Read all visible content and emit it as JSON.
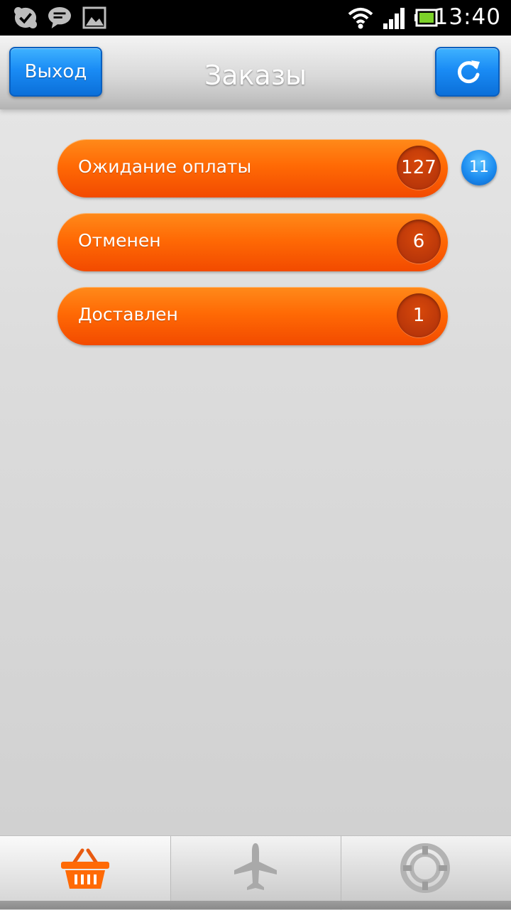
{
  "status_bar": {
    "time": "13:40",
    "left_icons": [
      "skype-icon",
      "chat-icon",
      "image-icon"
    ],
    "right_icons": [
      "wifi-icon",
      "signal-icon",
      "battery-icon"
    ]
  },
  "header": {
    "title": "Заказы",
    "exit_label": "Выход",
    "refresh_icon": "refresh-icon",
    "accent_color": "#1a8cf5"
  },
  "orders": {
    "items": [
      {
        "label": "Ожидание оплаты",
        "count": "127"
      },
      {
        "label": "Отменен",
        "count": "6"
      },
      {
        "label": "Доставлен",
        "count": "1"
      }
    ],
    "badge": "11",
    "pill_color": "#ff6a05"
  },
  "tabs": [
    {
      "icon": "basket-icon",
      "active": true
    },
    {
      "icon": "airplane-icon",
      "active": false
    },
    {
      "icon": "lifebuoy-icon",
      "active": false
    }
  ]
}
